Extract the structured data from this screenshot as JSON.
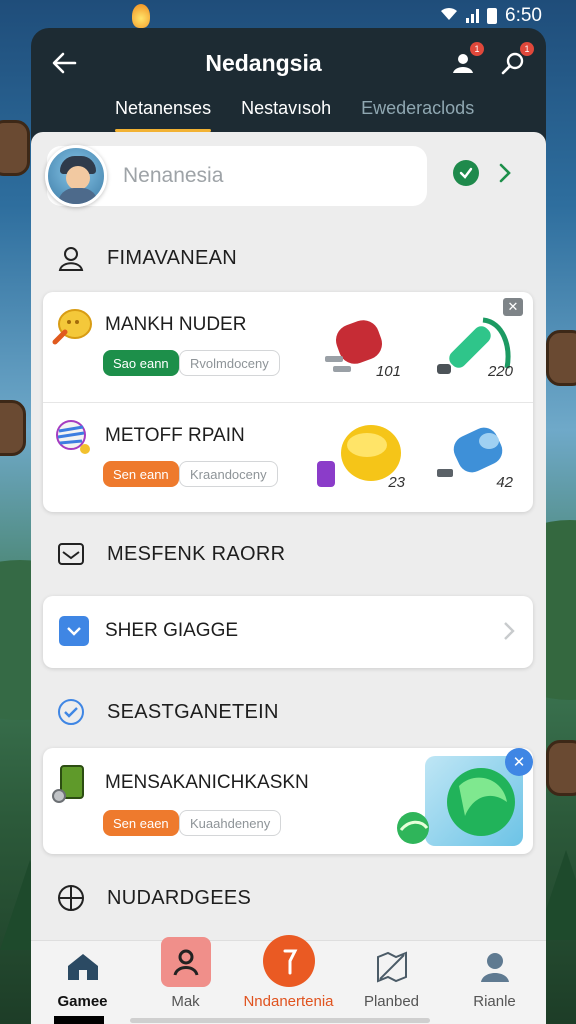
{
  "status_bar": {
    "time": "6:50"
  },
  "header": {
    "title": "Nedangsia"
  },
  "tabs": [
    {
      "label": "Netanenses",
      "active": true
    },
    {
      "label": "Nestavısoh",
      "active": false
    },
    {
      "label": "Ewederaclods",
      "active": false
    }
  ],
  "profile": {
    "search_placeholder": "Nenanesia"
  },
  "sections": {
    "first": "FIMAVANEAN",
    "second": "MESFENK RAORR",
    "third": "SEASTGANETEIN",
    "fourth": "NUDARDGEES"
  },
  "inventory": [
    {
      "title": "MANKH NUDER",
      "chip_primary": "Sao eann",
      "chip_primary_color": "#1d8f4a",
      "chip_secondary": "Rvolmdoceny",
      "items": [
        {
          "icon": "red-canister-icon",
          "qty": "101"
        },
        {
          "icon": "green-tube-icon",
          "qty": "220"
        }
      ]
    },
    {
      "title": "METOFF RPAIN",
      "chip_primary": "Sen eann",
      "chip_primary_color": "#ee7a2d",
      "chip_secondary": "Kraandoceny",
      "items": [
        {
          "icon": "yellow-orb-icon",
          "qty": "23"
        },
        {
          "icon": "blue-canister-icon",
          "qty": "42"
        }
      ]
    }
  ],
  "nav_card": {
    "label": "SHER GIAGGE"
  },
  "featured": {
    "title": "MENSAKANICHKASKN",
    "chip_primary": "Sen eaen",
    "chip_secondary": "Kuaahdeneny"
  },
  "bottom_nav": [
    {
      "label": "Gamee",
      "icon": "home-icon"
    },
    {
      "label": "Mak",
      "icon": "character-icon"
    },
    {
      "label": "Nndanertenia",
      "icon": "pin-icon"
    },
    {
      "label": "Planbed",
      "icon": "map-icon"
    },
    {
      "label": "Rianle",
      "icon": "person-icon"
    }
  ],
  "colors": {
    "accent": "#f2b233",
    "green": "#1d8f4a",
    "orange": "#ee7a2d",
    "header_bg": "#1d2b33"
  }
}
